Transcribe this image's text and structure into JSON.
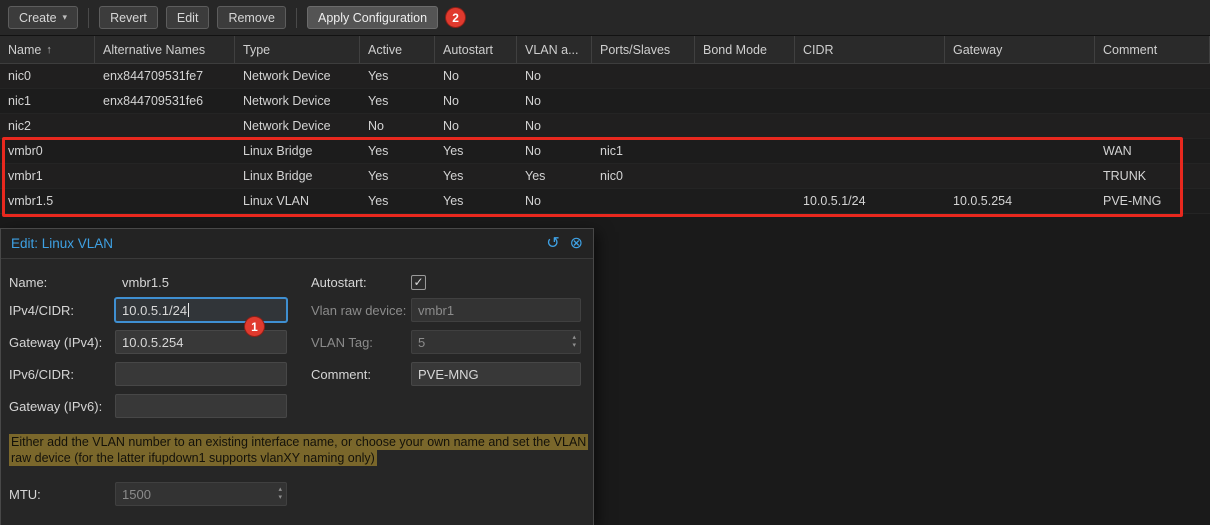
{
  "icons": {
    "caret_down": "▾",
    "sort_asc": "↑",
    "undo": "↺",
    "close": "⊗",
    "check": "✓",
    "spinner_up": "▴",
    "spinner_down": "▾"
  },
  "colors": {
    "accent_blue": "#3ea1e4",
    "annotation_red": "#e03a2e",
    "hint_highlight": "#7a672b"
  },
  "toolbar": {
    "create": "Create",
    "revert": "Revert",
    "edit": "Edit",
    "remove": "Remove",
    "apply": "Apply Configuration"
  },
  "annotations": {
    "step1": "1",
    "step2": "2"
  },
  "table": {
    "columns": [
      "Name",
      "Alternative Names",
      "Type",
      "Active",
      "Autostart",
      "VLAN a...",
      "Ports/Slaves",
      "Bond Mode",
      "CIDR",
      "Gateway",
      "Comment"
    ],
    "rows": [
      [
        "nic0",
        "enx844709531fe7",
        "Network Device",
        "Yes",
        "No",
        "No",
        "",
        "",
        "",
        "",
        ""
      ],
      [
        "nic1",
        "enx844709531fe6",
        "Network Device",
        "Yes",
        "No",
        "No",
        "",
        "",
        "",
        "",
        ""
      ],
      [
        "nic2",
        "",
        "Network Device",
        "No",
        "No",
        "No",
        "",
        "",
        "",
        "",
        ""
      ],
      [
        "vmbr0",
        "",
        "Linux Bridge",
        "Yes",
        "Yes",
        "No",
        "nic1",
        "",
        "",
        "",
        "WAN"
      ],
      [
        "vmbr1",
        "",
        "Linux Bridge",
        "Yes",
        "Yes",
        "Yes",
        "nic0",
        "",
        "",
        "",
        "TRUNK"
      ],
      [
        "vmbr1.5",
        "",
        "Linux VLAN",
        "Yes",
        "Yes",
        "No",
        "",
        "",
        "10.0.5.1/24",
        "10.0.5.254",
        "PVE-MNG"
      ]
    ]
  },
  "dialog": {
    "title": "Edit: Linux VLAN",
    "fields": {
      "name_label": "Name:",
      "name_value": "vmbr1.5",
      "ipv4_label": "IPv4/CIDR:",
      "ipv4_value": "10.0.5.1/24",
      "gw4_label": "Gateway (IPv4):",
      "gw4_value": "10.0.5.254",
      "ipv6_label": "IPv6/CIDR:",
      "ipv6_value": "",
      "gw6_label": "Gateway (IPv6):",
      "gw6_value": "",
      "autostart_label": "Autostart:",
      "vlanraw_label": "Vlan raw device:",
      "vlanraw_value": "vmbr1",
      "vlantag_label": "VLAN Tag:",
      "vlantag_value": "5",
      "comment_label": "Comment:",
      "comment_value": "PVE-MNG",
      "mtu_label": "MTU:",
      "mtu_value": "1500"
    },
    "hint": "Either add the VLAN number to an existing interface name, or choose your own name and set the VLAN raw device (for the latter ifupdown1 supports vlanXY naming only)"
  }
}
